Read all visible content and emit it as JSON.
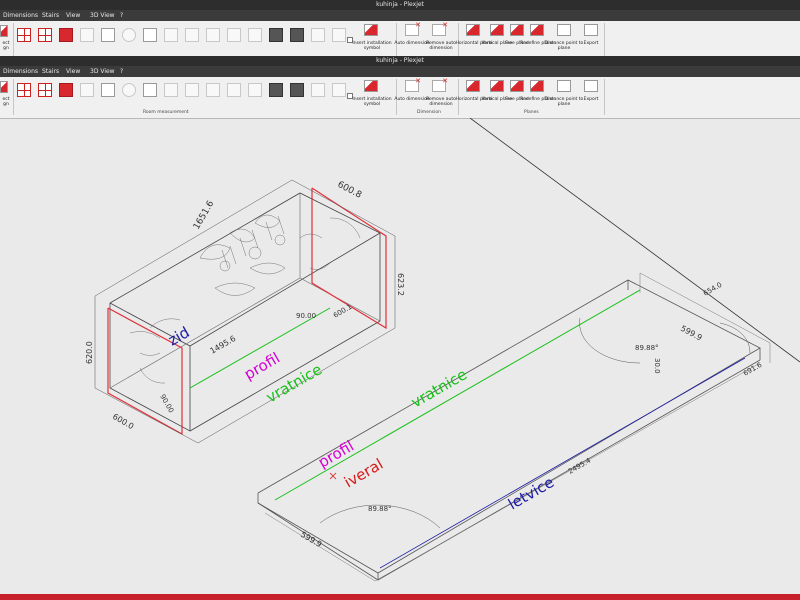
{
  "window": {
    "title": "kuhinja - Plexjet"
  },
  "menu": {
    "items": [
      "Dimensions",
      "Stairs",
      "View",
      "3D View",
      "?"
    ],
    "items_lower": [
      "Dimensions",
      "Stairs",
      "View",
      "3D View",
      "?"
    ]
  },
  "ribbon_top": {
    "left_cut_label": "ect",
    "left_cut_label2": "gn",
    "insert_installation": "Insert installation symbol",
    "auto_dimension": "Auto dimension",
    "remove_auto": "Remove auto dimension",
    "horizontal_plane": "Horizontal plane",
    "vertical_plane": "Vertical plane",
    "free_plane": "Free plane",
    "redefine_plane": "Redefine plane",
    "distance_point": "Distance point to plane",
    "export": "Export"
  },
  "ribbon_bottom": {
    "left_cut_label": "ect",
    "left_cut_label2": "gn",
    "insert_installation": "Insert installation symbol",
    "auto_dimension": "Auto dimension",
    "remove_auto": "Remove auto dimension",
    "horizontal_plane": "Horizontal plane",
    "vertical_plane": "Vertical plane",
    "free_plane": "Free plane",
    "redefine_plane": "Redefine plane",
    "distance_point": "Distance point to plane",
    "export": "Export",
    "groups": {
      "room_measurement": "Room measurement",
      "dimension": "Dimension",
      "planes": "Planes"
    }
  },
  "drawing": {
    "labels": {
      "zid": "zid",
      "profil_left": "profil",
      "vratnice_left": "vratnice",
      "vratnice_right": "vratnice",
      "profil_right": "profil",
      "iveral": "iveral",
      "letvice": "letvice"
    },
    "dimensions": {
      "d1651": "1651.6",
      "d600_top": "600.8",
      "d623": "623.2",
      "d600_mid": "600.1",
      "d90_a": "90.00",
      "d90_b": "90.00",
      "d620": "620.0",
      "d600_left": "600.0",
      "d1495": "1495.6",
      "d90_c": "89.88°",
      "d654": "654.0",
      "d599": "599.9",
      "d2495": "2495.4",
      "d90_d": "89.88°",
      "d599b": "599.9",
      "d30": "30.0",
      "d691": "691.6"
    },
    "colors": {
      "zid": "#1a1aa6",
      "profil": "#d400d4",
      "vratnice": "#18c018",
      "iveral": "#d61a1a",
      "letvice": "#1a1aa6",
      "red_edge": "#e0303a"
    }
  }
}
